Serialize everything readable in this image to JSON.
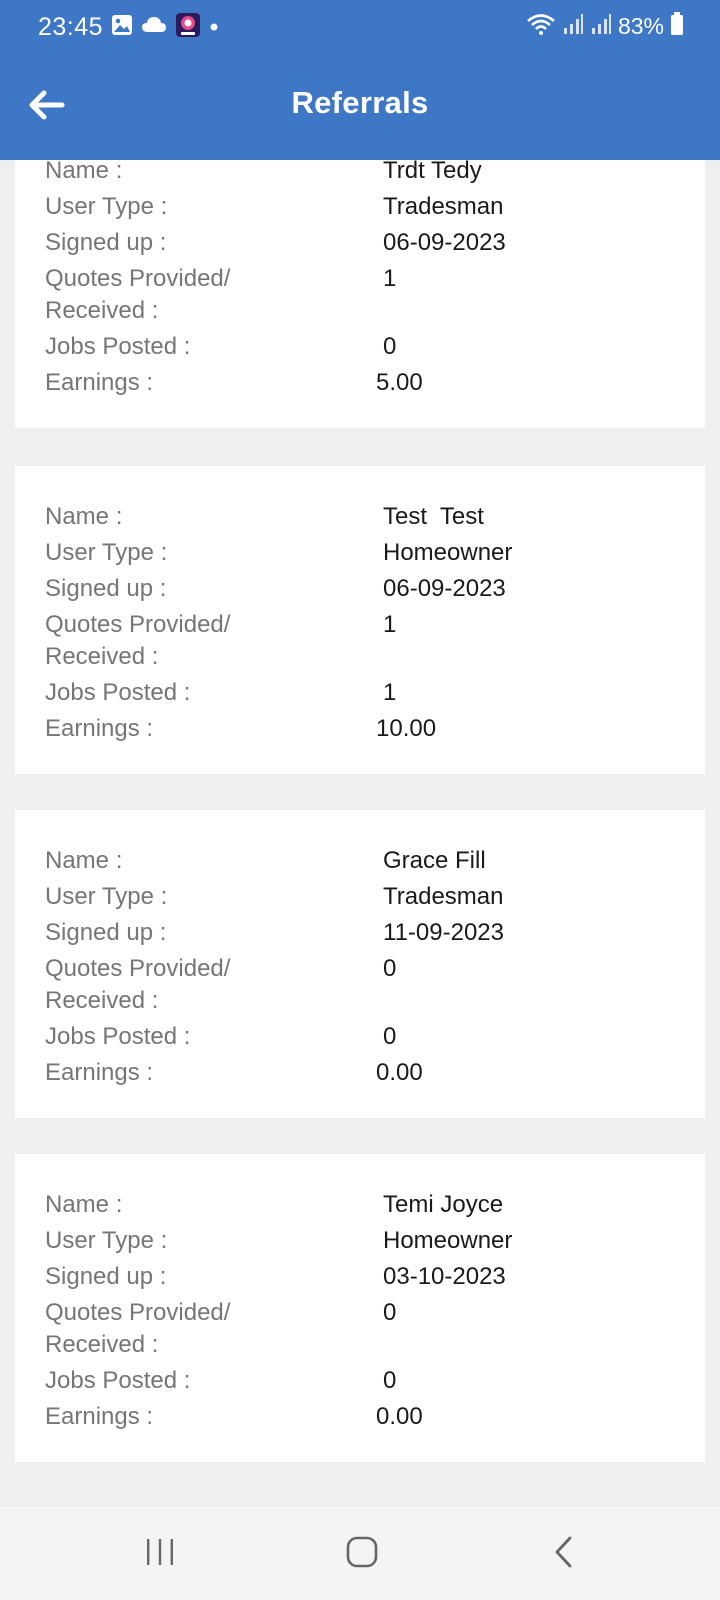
{
  "status_bar": {
    "time": "23:45",
    "battery": "83%",
    "icons": [
      "image-icon",
      "cloud-icon",
      "app-notification-icon",
      "dot-icon",
      "wifi-icon",
      "signal-icon",
      "signal-icon",
      "battery-icon"
    ]
  },
  "app_bar": {
    "title": "Referrals",
    "back_icon": "arrow-left-icon",
    "color": "#3d77c6"
  },
  "labels": {
    "name": "Name :",
    "user_type": "User Type :",
    "signed_up": "Signed up :",
    "quotes_line1": "Quotes Provided/",
    "quotes_line2": "Received :",
    "jobs_posted": "Jobs Posted :",
    "earnings": "Earnings :"
  },
  "referrals": [
    {
      "name": "Trdt Tedy",
      "user_type": "Tradesman",
      "signed_up": "06-09-2023",
      "quotes": "1",
      "jobs_posted": "0",
      "earnings": "5.00"
    },
    {
      "name": "Test  Test",
      "user_type": "Homeowner",
      "signed_up": "06-09-2023",
      "quotes": "1",
      "jobs_posted": "1",
      "earnings": "10.00"
    },
    {
      "name": "Grace Fill",
      "user_type": "Tradesman",
      "signed_up": "11-09-2023",
      "quotes": "0",
      "jobs_posted": "0",
      "earnings": "0.00"
    },
    {
      "name": "Temi Joyce",
      "user_type": "Homeowner",
      "signed_up": "03-10-2023",
      "quotes": "0",
      "jobs_posted": "0",
      "earnings": "0.00"
    }
  ],
  "nav_bar": {
    "icons": [
      "recent-apps-icon",
      "home-icon",
      "back-icon"
    ]
  }
}
